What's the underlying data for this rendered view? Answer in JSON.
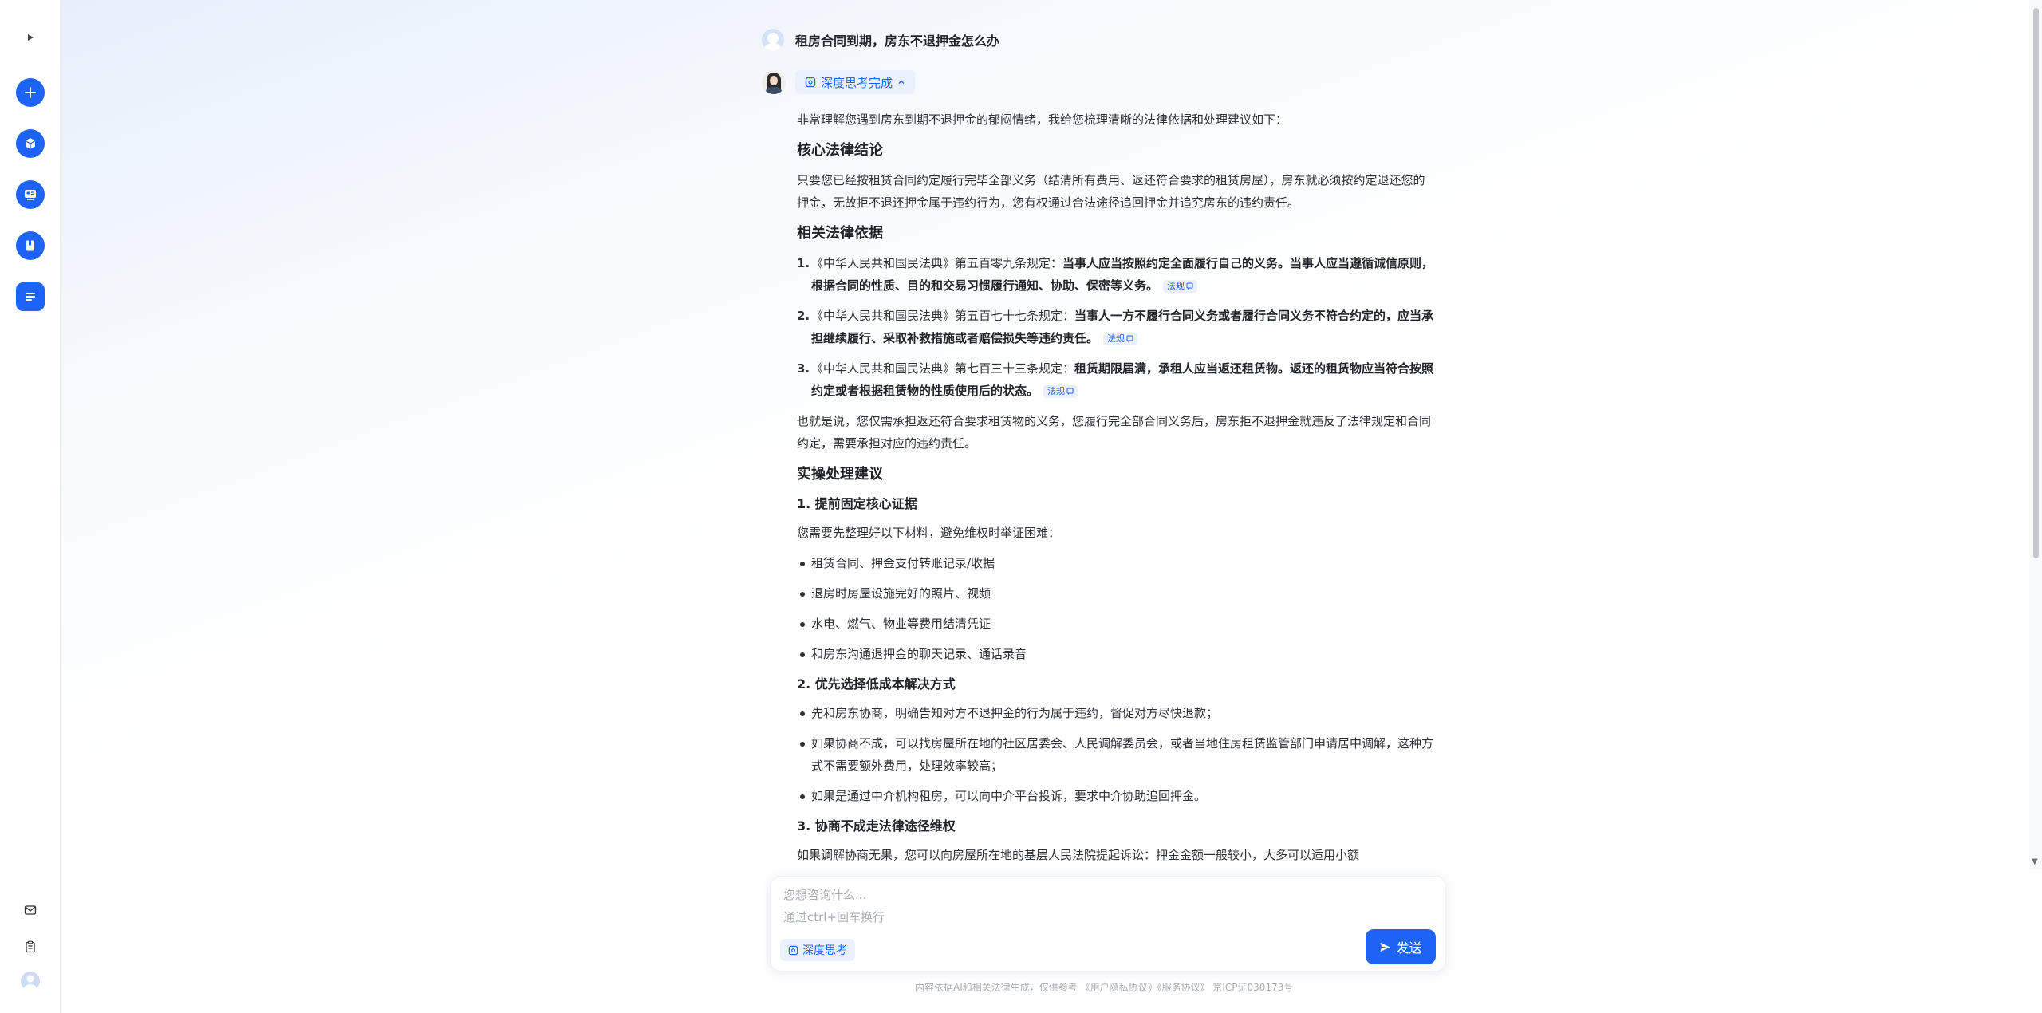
{
  "sidebar": {
    "toggle_icon": "play-icon",
    "buttons": [
      {
        "name": "new-chat-button",
        "icon": "plus-icon"
      },
      {
        "name": "cube-app-button",
        "icon": "cube-icon"
      },
      {
        "name": "card-app-button",
        "icon": "id-card-icon"
      },
      {
        "name": "book-app-button",
        "icon": "bookmark-icon"
      },
      {
        "name": "doc-app-button",
        "icon": "document-icon"
      }
    ],
    "bottom": [
      "mail-icon",
      "clipboard-icon",
      "avatar"
    ]
  },
  "conversation": {
    "question": "租房合同到期，房东不退押金怎么办",
    "think_badge": "深度思考完成",
    "intro": "非常理解您遇到房东到期不退押金的郁闷情绪，我给您梳理清晰的法律依据和处理建议如下：",
    "section1_title": "核心法律结论",
    "section1_text": "只要您已经按租赁合同约定履行完毕全部义务（结清所有费用、返还符合要求的租赁房屋），房东就必须按约定退还您的押金，无故拒不退还押金属于违约行为，您有权通过合法途径追回押金并追究房东的违约责任。",
    "section2_title": "相关法律依据",
    "laws": [
      {
        "num": "1.",
        "prefix": "《中华人民共和国民法典》第五百零九条规定：",
        "bold": "当事人应当按照约定全面履行自己的义务。当事人应当遵循诚信原则，根据合同的性质、目的和交易习惯履行通知、协助、保密等义务。",
        "tag": "法规"
      },
      {
        "num": "2.",
        "prefix": "《中华人民共和国民法典》第五百七十七条规定：",
        "bold": "当事人一方不履行合同义务或者履行合同义务不符合约定的，应当承担继续履行、采取补救措施或者赔偿损失等违约责任。",
        "tag": "法规"
      },
      {
        "num": "3.",
        "prefix": "《中华人民共和国民法典》第七百三十三条规定：",
        "bold": "租赁期限届满，承租人应当返还租赁物。返还的租赁物应当符合按照约定或者根据租赁物的性质使用后的状态。",
        "tag": "法规"
      }
    ],
    "section2_summary": "也就是说，您仅需承担返还符合要求租赁物的义务，您履行完全部合同义务后，房东拒不退押金就违反了法律规定和合同约定，需要承担对应的违约责任。",
    "section3_title": "实操处理建议",
    "step1_title": "1. 提前固定核心证据",
    "step1_intro": "您需要先整理好以下材料，避免维权时举证困难：",
    "step1_items": [
      "租赁合同、押金支付转账记录/收据",
      "退房时房屋设施完好的照片、视频",
      "水电、燃气、物业等费用结清凭证",
      "和房东沟通退押金的聊天记录、通话录音"
    ],
    "step2_title": "2. 优先选择低成本解决方式",
    "step2_items": [
      "先和房东协商，明确告知对方不退押金的行为属于违约，督促对方尽快退款；",
      "如果协商不成，可以找房屋所在地的社区居委会、人民调解委员会，或者当地住房租赁监管部门申请居中调解，这种方式不需要额外费用，处理效率较高；",
      "如果是通过中介机构租房，可以向中介平台投诉，要求中介协助追回押金。"
    ],
    "step3_title": "3. 协商不成走法律途径维权",
    "step3_text": "如果调解协商无果，您可以向房屋所在地的基层人民法院提起诉讼：押金金额一般较小，大多可以适用小额"
  },
  "input": {
    "placeholder": "您想咨询什么...",
    "hint": "通过ctrl+回车换行",
    "deep_think_label": "深度思考",
    "send_label": "发送"
  },
  "footer": {
    "text": "内容依据AI和相关法律生成，仅供参考 《用户隐私协议》《服务协议》 京ICP证030173号"
  },
  "colors": {
    "accent": "#1d63f5",
    "accent_light": "#eaf1fd",
    "text": "#1f2329",
    "muted": "#a8adb6"
  }
}
